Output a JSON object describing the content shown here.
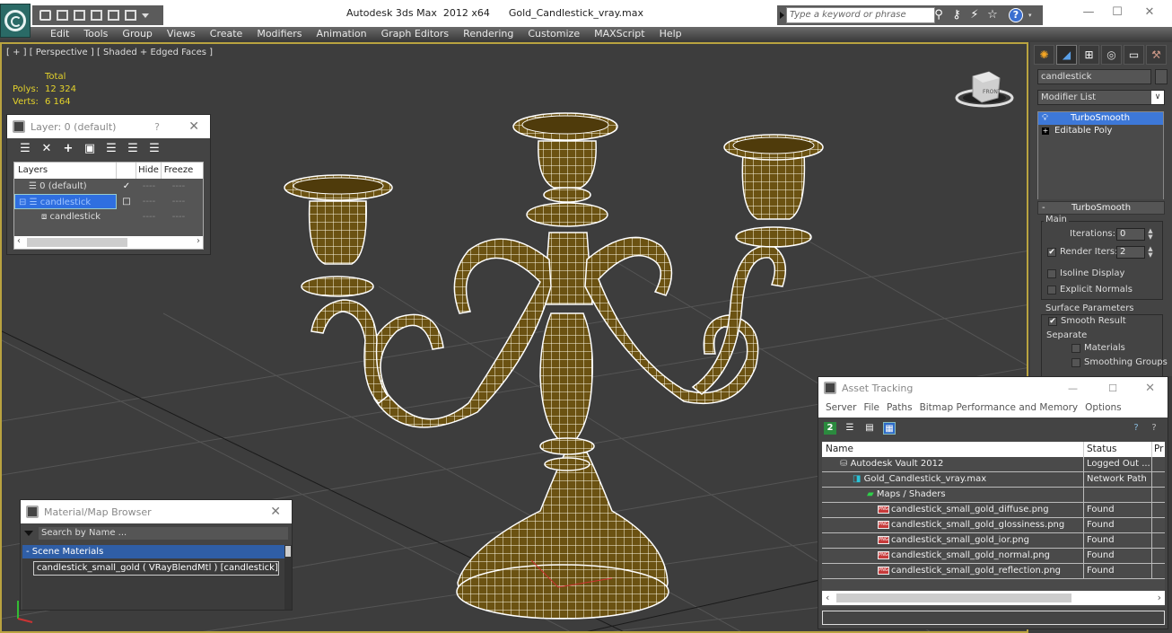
{
  "app": {
    "title": "Autodesk 3ds Max  2012 x64",
    "document": "Gold_Candlestick_vray.max",
    "search_placeholder": "Type a keyword or phrase"
  },
  "menu": [
    "Edit",
    "Tools",
    "Group",
    "Views",
    "Create",
    "Modifiers",
    "Animation",
    "Graph Editors",
    "Rendering",
    "Customize",
    "MAXScript",
    "Help"
  ],
  "viewport": {
    "label": "[ + ] [ Perspective ] [ Shaded + Edged Faces ]",
    "stats": {
      "header": "Total",
      "polys_label": "Polys:",
      "polys": "12 324",
      "verts_label": "Verts:",
      "verts": "6 164"
    },
    "viewcube_face": "FRONT",
    "border_color": "#b9a340",
    "model_color": "#6b5212",
    "wire_color": "#ffffff"
  },
  "layer_dialog": {
    "title": "Layer: 0 (default)",
    "help": "?",
    "toolbar": [
      "create-layer",
      "delete-layer",
      "add-selection",
      "select-objects",
      "select-layer",
      "highlight",
      "hide-all"
    ],
    "columns": [
      "Layers",
      "",
      "Hide",
      "Freeze"
    ],
    "rows": [
      {
        "name": "0 (default)",
        "current": "✓",
        "hide": "----",
        "freeze": "----",
        "selected": false,
        "indent": 1
      },
      {
        "name": "candlestick",
        "current": "□",
        "hide": "----",
        "freeze": "----",
        "selected": true,
        "indent": 1
      },
      {
        "name": "candlestick",
        "current": "",
        "hide": "----",
        "freeze": "----",
        "selected": false,
        "indent": 2
      }
    ]
  },
  "command_panel": {
    "tabs": [
      "create",
      "modify",
      "hierarchy",
      "motion",
      "display",
      "utilities"
    ],
    "object_name": "candlestick",
    "modifier_list": "Modifier List",
    "stack": [
      "TurboSmooth",
      "Editable Poly"
    ],
    "rollout": {
      "title": "TurboSmooth",
      "main_group": "Main",
      "iterations_label": "Iterations:",
      "iterations": "0",
      "render_iters_label": "Render Iters:",
      "render_iters": "2",
      "render_iters_checked": true,
      "isoline_label": "Isoline Display",
      "isoline_checked": false,
      "explicit_label": "Explicit Normals",
      "explicit_checked": false,
      "surface_group": "Surface Parameters",
      "smooth_result_label": "Smooth Result",
      "smooth_result_checked": true,
      "separate_label": "Separate",
      "materials_label": "Materials",
      "materials_checked": false,
      "smoothing_groups_label": "Smoothing Groups",
      "smoothing_groups_checked": false
    }
  },
  "material_browser": {
    "title": "Material/Map Browser",
    "search_placeholder": "Search by Name ...",
    "category": "- Scene Materials",
    "entry": "candlestick_small_gold ( VRayBlendMtl ) [candlestick]"
  },
  "asset_tracking": {
    "title": "Asset Tracking",
    "menu": [
      "Server",
      "File",
      "Paths",
      "Bitmap Performance and Memory",
      "Options"
    ],
    "columns": [
      "Name",
      "Status",
      "Pr"
    ],
    "rows": [
      {
        "name": "Autodesk Vault 2012",
        "status": "Logged Out ...",
        "icon": "vault-icon",
        "indent": 1
      },
      {
        "name": "Gold_Candlestick_vray.max",
        "status": "Network Path",
        "icon": "max-file-icon",
        "indent": 2
      },
      {
        "name": "Maps / Shaders",
        "status": "",
        "icon": "maps-icon",
        "indent": 3
      },
      {
        "name": "candlestick_small_gold_diffuse.png",
        "status": "Found",
        "icon": "png-icon",
        "indent": 4
      },
      {
        "name": "candlestick_small_gold_glossiness.png",
        "status": "Found",
        "icon": "png-icon",
        "indent": 4
      },
      {
        "name": "candlestick_small_gold_ior.png",
        "status": "Found",
        "icon": "png-icon",
        "indent": 4
      },
      {
        "name": "candlestick_small_gold_normal.png",
        "status": "Found",
        "icon": "png-icon",
        "indent": 4
      },
      {
        "name": "candlestick_small_gold_reflection.png",
        "status": "Found",
        "icon": "png-icon",
        "indent": 4
      }
    ],
    "png_badge": "PNG"
  }
}
